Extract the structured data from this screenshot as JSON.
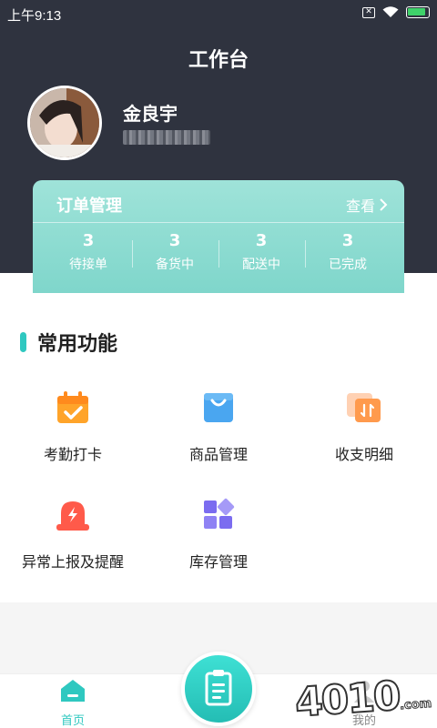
{
  "status_bar": {
    "time": "上午9:13"
  },
  "header": {
    "title": "工作台"
  },
  "user": {
    "name": "金良宇",
    "phone": "13870355690"
  },
  "order_card": {
    "title": "订单管理",
    "view_label": "查看",
    "stats": [
      {
        "count": "3",
        "label": "待接单"
      },
      {
        "count": "3",
        "label": "备货中"
      },
      {
        "count": "3",
        "label": "配送中"
      },
      {
        "count": "3",
        "label": "已完成"
      }
    ]
  },
  "functions": {
    "title": "常用功能",
    "items": [
      {
        "label": "考勤打卡",
        "icon": "calendar-check-icon"
      },
      {
        "label": "商品管理",
        "icon": "shopping-bag-icon"
      },
      {
        "label": "收支明细",
        "icon": "card-transfer-icon"
      },
      {
        "label": "异常上报及提醒",
        "icon": "alarm-light-icon"
      },
      {
        "label": "库存管理",
        "icon": "grid-blocks-icon"
      }
    ]
  },
  "tabbar": {
    "items": [
      {
        "label": "首页",
        "icon": "home-icon",
        "active": true
      },
      {
        "label": "我的",
        "icon": "profile-icon",
        "active": false
      }
    ],
    "center_icon": "clipboard-icon"
  },
  "watermark": {
    "text": "4010",
    "suffix": ".com"
  },
  "colors": {
    "accent": "#2fc8c0",
    "header": "#2f333f",
    "card": "#8fdcd1"
  }
}
